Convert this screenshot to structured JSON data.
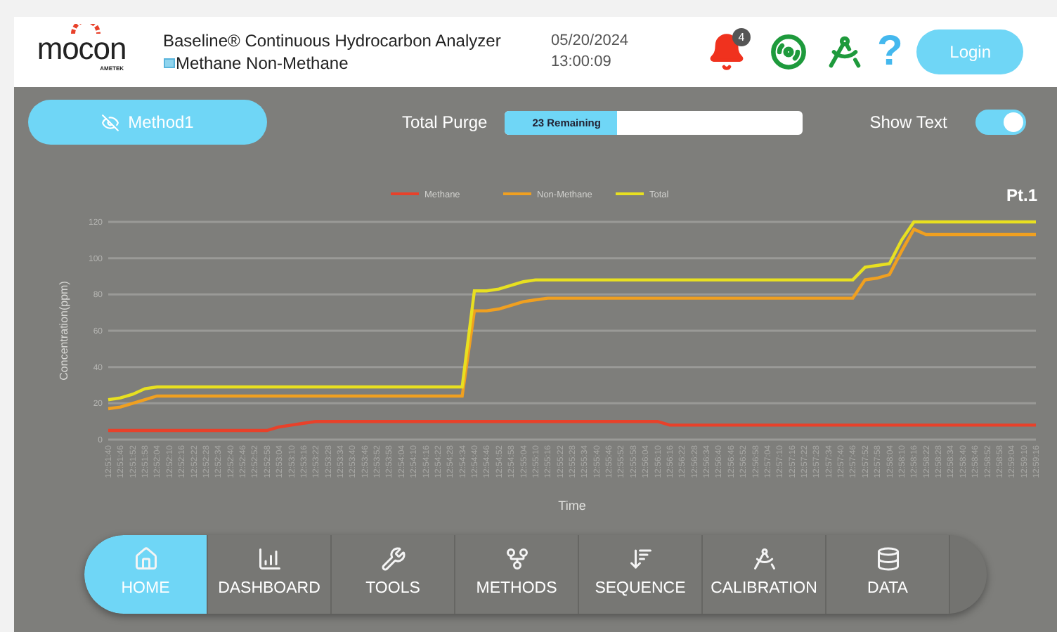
{
  "header": {
    "logo": "mocon",
    "logo_sub": "AMETEK",
    "title": "Baseline® Continuous Hydrocarbon Analyzer",
    "subtitle": "Methane Non-Methane",
    "date": "05/20/2024",
    "time": "13:00:09",
    "alert_count": "4",
    "help": "?",
    "login": "Login"
  },
  "toolbar": {
    "method": "Method1",
    "purge_label": "Total Purge",
    "purge_text": "23 Remaining",
    "purge": {
      "level": 0.38
    },
    "show_text_label": "Show Text",
    "show_text": {
      "on": true
    }
  },
  "chart": {
    "point": "Pt.1",
    "chart_data": {
      "type": "line",
      "xlabel": "Time",
      "ylabel": "Concentration(ppm)",
      "ylim": [
        0,
        120
      ],
      "grid": true,
      "legend": "top",
      "yticks": [
        0,
        20,
        40,
        60,
        80,
        100,
        120
      ],
      "categories": [
        "12:51:40",
        "12:51:46",
        "12:51:52",
        "12:51:58",
        "12:52:04",
        "12:52:10",
        "12:52:16",
        "12:52:22",
        "12:52:28",
        "12:52:34",
        "12:52:40",
        "12:52:46",
        "12:52:52",
        "12:52:58",
        "12:53:04",
        "12:53:10",
        "12:53:16",
        "12:53:22",
        "12:53:28",
        "12:53:34",
        "12:53:40",
        "12:53:46",
        "12:53:52",
        "12:53:58",
        "12:54:04",
        "12:54:10",
        "12:54:16",
        "12:54:22",
        "12:54:28",
        "12:54:34",
        "12:54:40",
        "12:54:46",
        "12:54:52",
        "12:54:58",
        "12:55:04",
        "12:55:10",
        "12:55:16",
        "12:55:22",
        "12:55:28",
        "12:55:34",
        "12:55:40",
        "12:55:46",
        "12:55:52",
        "12:55:58",
        "12:56:04",
        "12:56:10",
        "12:56:16",
        "12:56:22",
        "12:56:28",
        "12:56:34",
        "12:56:40",
        "12:56:46",
        "12:56:52",
        "12:56:58",
        "12:57:04",
        "12:57:10",
        "12:57:16",
        "12:57:22",
        "12:57:28",
        "12:57:34",
        "12:57:40",
        "12:57:46",
        "12:57:52",
        "12:57:58",
        "12:58:04",
        "12:58:10",
        "12:58:16",
        "12:58:22",
        "12:58:28",
        "12:58:34",
        "12:58:40",
        "12:58:46",
        "12:58:52",
        "12:58:58",
        "12:59:04",
        "12:59:10",
        "12:59:16"
      ],
      "series": [
        {
          "name": "Methane",
          "color": "#e8412a",
          "values": [
            5,
            5,
            5,
            5,
            5,
            5,
            5,
            5,
            5,
            5,
            5,
            5,
            5,
            5,
            7,
            8,
            9,
            10,
            10,
            10,
            10,
            10,
            10,
            10,
            10,
            10,
            10,
            10,
            10,
            10,
            10,
            10,
            10,
            10,
            10,
            10,
            10,
            10,
            10,
            10,
            10,
            10,
            10,
            10,
            10,
            10,
            8,
            8,
            8,
            8,
            8,
            8,
            8,
            8,
            8,
            8,
            8,
            8,
            8,
            8,
            8,
            8,
            8,
            8,
            8,
            8,
            8,
            8,
            8,
            8,
            8,
            8,
            8,
            8,
            8,
            8,
            8
          ]
        },
        {
          "name": "Non-Methane",
          "color": "#f0a020",
          "values": [
            17,
            18,
            20,
            22,
            24,
            24,
            24,
            24,
            24,
            24,
            24,
            24,
            24,
            24,
            24,
            24,
            24,
            24,
            24,
            24,
            24,
            24,
            24,
            24,
            24,
            24,
            24,
            24,
            24,
            24,
            71,
            71,
            72,
            74,
            76,
            77,
            78,
            78,
            78,
            78,
            78,
            78,
            78,
            78,
            78,
            78,
            78,
            78,
            78,
            78,
            78,
            78,
            78,
            78,
            78,
            78,
            78,
            78,
            78,
            78,
            78,
            78,
            88,
            89,
            91,
            104,
            116,
            113,
            113,
            113,
            113,
            113,
            113,
            113,
            113,
            113,
            113
          ]
        },
        {
          "name": "Total",
          "color": "#e8e020",
          "values": [
            22,
            23,
            25,
            28,
            29,
            29,
            29,
            29,
            29,
            29,
            29,
            29,
            29,
            29,
            29,
            29,
            29,
            29,
            29,
            29,
            29,
            29,
            29,
            29,
            29,
            29,
            29,
            29,
            29,
            29,
            82,
            82,
            83,
            85,
            87,
            88,
            88,
            88,
            88,
            88,
            88,
            88,
            88,
            88,
            88,
            88,
            88,
            88,
            88,
            88,
            88,
            88,
            88,
            88,
            88,
            88,
            88,
            88,
            88,
            88,
            88,
            88,
            95,
            96,
            97,
            110,
            120,
            120,
            120,
            120,
            120,
            120,
            120,
            120,
            120,
            120,
            120
          ]
        }
      ]
    }
  },
  "nav": [
    {
      "label": "HOME",
      "kind": "home",
      "selected": true
    },
    {
      "label": "DASHBOARD",
      "kind": "dashboard",
      "selected": false
    },
    {
      "label": "TOOLS",
      "kind": "tools",
      "selected": false
    },
    {
      "label": "METHODS",
      "kind": "methods",
      "selected": false
    },
    {
      "label": "SEQUENCE",
      "kind": "sequence",
      "selected": false
    },
    {
      "label": "CALIBRATION",
      "kind": "calibration",
      "selected": false
    },
    {
      "label": "DATA",
      "kind": "data",
      "selected": false
    }
  ]
}
